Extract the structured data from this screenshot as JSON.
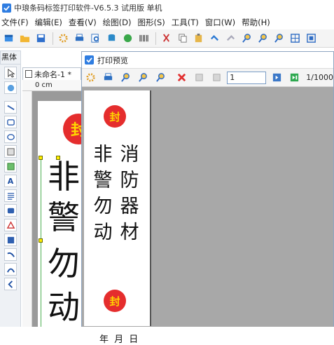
{
  "app": {
    "title": "中琅条码标签打印软件-V6.5.3 试用版 单机"
  },
  "menu": {
    "items": [
      {
        "label": "文件(F)"
      },
      {
        "label": "编辑(E)"
      },
      {
        "label": "查看(V)"
      },
      {
        "label": "绘图(D)"
      },
      {
        "label": "图形(S)"
      },
      {
        "label": "工具(T)"
      },
      {
        "label": "窗口(W)"
      },
      {
        "label": "帮助(H)"
      }
    ]
  },
  "panel": {
    "header": "黑体"
  },
  "document": {
    "tab_label": "未命名-1 *",
    "ruler_unit": "0 cm"
  },
  "canvas": {
    "text_lines": [
      "非",
      "警",
      "勿",
      "动"
    ]
  },
  "preview": {
    "window_title": "打印预览",
    "page_input": "1",
    "page_total": "1/1000",
    "label": {
      "seal_char": "封",
      "col_right": [
        "消",
        "防",
        "器",
        "材"
      ],
      "col_left": [
        "非",
        "警",
        "勿",
        "动"
      ],
      "date_text": "年 月 日"
    }
  },
  "colors": {
    "seal_red": "#e52d2d",
    "seal_text": "#ffd700",
    "accent_blue": "#2f7de1"
  }
}
